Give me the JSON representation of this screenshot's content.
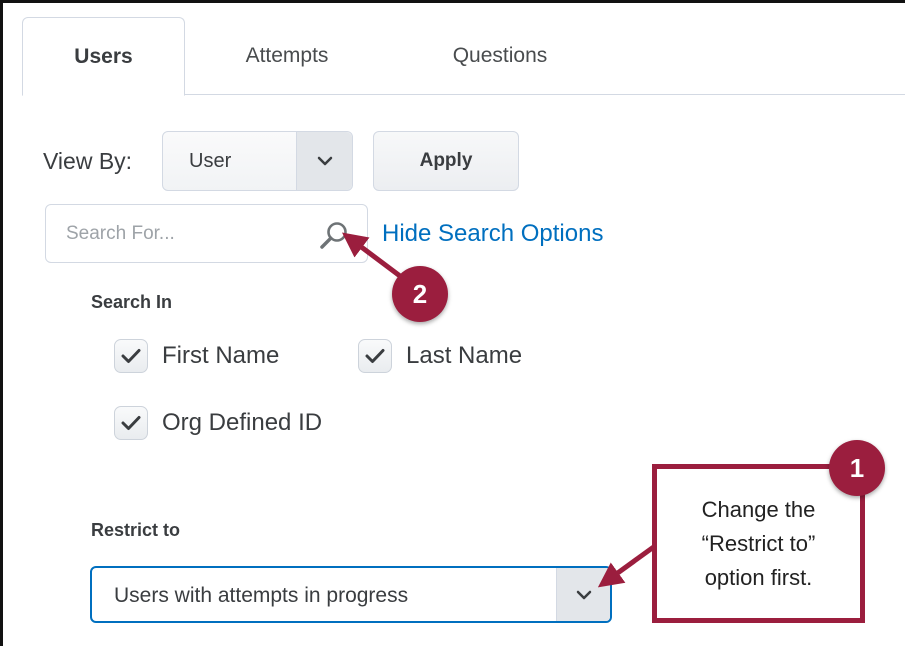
{
  "tabs": [
    {
      "label": "Users",
      "active": true
    },
    {
      "label": "Attempts",
      "active": false
    },
    {
      "label": "Questions",
      "active": false
    }
  ],
  "view_by": {
    "label": "View By:",
    "selected": "User",
    "apply_label": "Apply"
  },
  "search": {
    "placeholder": "Search For...",
    "value": "",
    "hide_link": "Hide Search Options",
    "search_in_label": "Search In",
    "options": [
      {
        "label": "First Name",
        "checked": true
      },
      {
        "label": "Last Name",
        "checked": true
      },
      {
        "label": "Org Defined ID",
        "checked": true
      }
    ]
  },
  "restrict": {
    "label": "Restrict to",
    "selected": "Users with attempts in progress"
  },
  "annotations": {
    "callout_text_line1": "Change the",
    "callout_text_line2": "“Restrict to”",
    "callout_text_line3": "option first.",
    "badge1": "1",
    "badge2": "2",
    "accent_color": "#9b1e3e",
    "link_color": "#006fbf"
  }
}
